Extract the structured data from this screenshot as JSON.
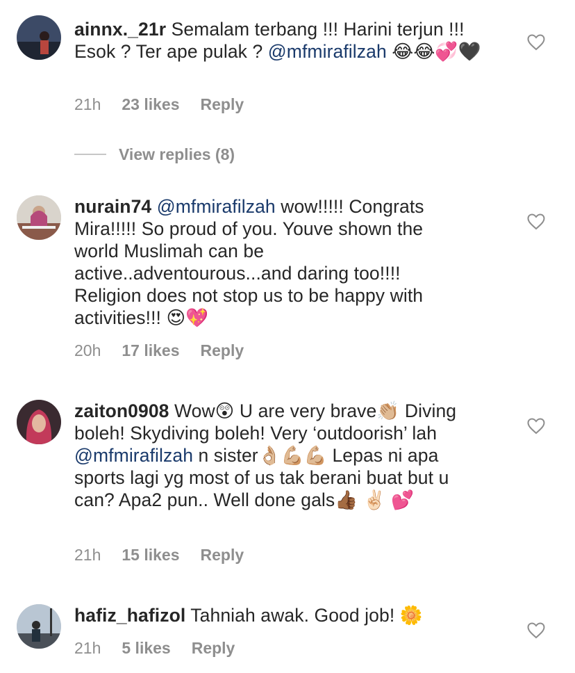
{
  "comments": [
    {
      "username": "ainnx._21r",
      "text_before": " Semalam terbang !!! Harini terjun !!! Esok ? Ter ape pulak ? ",
      "mention": "@mfmirafilzah",
      "text_after": " 😂😂💞🖤",
      "time": "21h",
      "likes": "23 likes",
      "reply": "Reply"
    },
    {
      "username": "nurain74",
      "text_before": " ",
      "mention": "@mfmirafilzah",
      "text_after": " wow!!!!! Congrats Mira!!!!! So proud of you. Youve shown the world Muslimah can be active..adventourous...and daring too!!!! Religion does not stop us to be happy with activities!!! 😍💖",
      "time": "20h",
      "likes": "17 likes",
      "reply": "Reply"
    },
    {
      "username": "zaiton0908",
      "text_before": " Wow😲 U are very brave👏🏼 Diving boleh! Skydiving boleh! Very ‘outdoorish’ lah ",
      "mention": "@mfmirafilzah",
      "text_after": " n sister👌🏼💪🏼💪🏼 Lepas ni apa sports lagi yg most of us tak berani buat but u can? Apa2 pun.. Well done gals👍🏾 ✌🏻 💕",
      "time": "21h",
      "likes": "15 likes",
      "reply": "Reply"
    },
    {
      "username": "hafiz_hafizol",
      "text_before": " Tahniah awak. Good job! 🌼",
      "mention": "",
      "text_after": "",
      "time": "21h",
      "likes": "5 likes",
      "reply": "Reply"
    }
  ],
  "view_replies": "View replies (8)",
  "icons": {
    "like": "heart-outline-icon"
  },
  "colors": {
    "mention": "#1a3a6b",
    "meta": "#8e8e8e",
    "text": "#262626"
  }
}
